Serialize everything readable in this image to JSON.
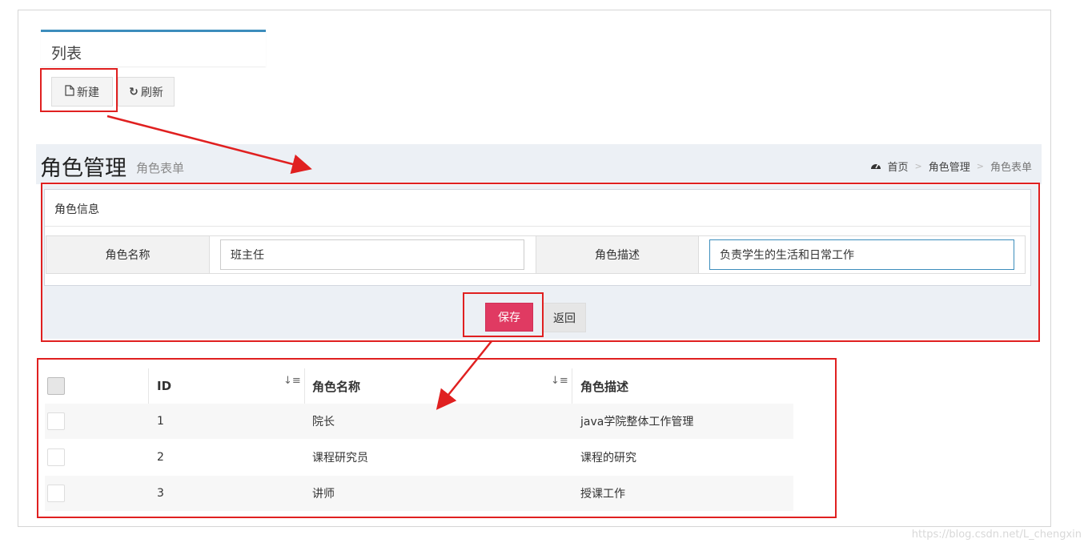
{
  "list_panel": {
    "title": "列表"
  },
  "toolbar": {
    "new_label": "新建",
    "refresh_label": "刷新",
    "new_icon": "file-icon",
    "refresh_icon": "refresh-icon"
  },
  "page_header": {
    "title": "角色管理",
    "subtitle": "角色表单",
    "breadcrumb": [
      "首页",
      "角色管理",
      "角色表单"
    ],
    "breadcrumb_icon": "dashboard-icon"
  },
  "form": {
    "panel_title": "角色信息",
    "name_label": "角色名称",
    "name_value": "班主任",
    "desc_label": "角色描述",
    "desc_value": "负责学生的生活和日常工作",
    "save_label": "保存",
    "back_label": "返回"
  },
  "table": {
    "headers": [
      "ID",
      "角色名称",
      "角色描述"
    ],
    "rows": [
      {
        "id": "1",
        "name": "院长",
        "desc": "java学院整体工作管理"
      },
      {
        "id": "2",
        "name": "课程研究员",
        "desc": "课程的研究"
      },
      {
        "id": "3",
        "name": "讲师",
        "desc": "授课工作"
      }
    ]
  },
  "watermark": "https://blog.csdn.net/L_chengxin",
  "colors": {
    "accent": "#3c8dbc",
    "save_button": "#e03a62",
    "annotation_red": "#e02020"
  }
}
